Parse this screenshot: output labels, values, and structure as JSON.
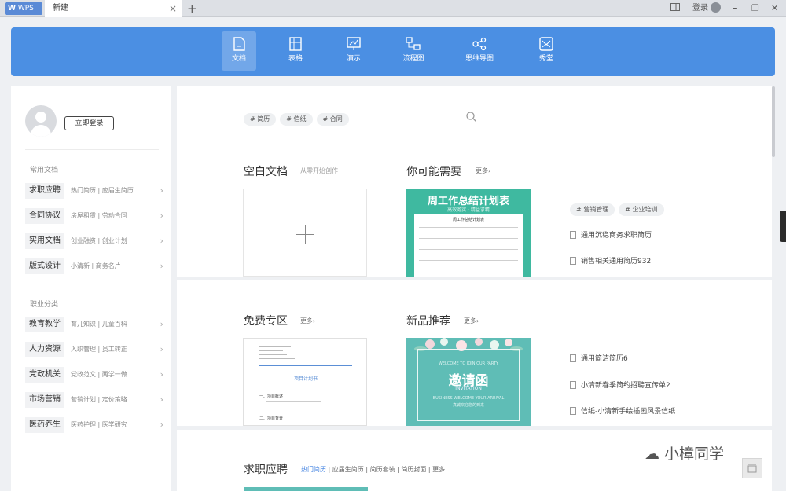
{
  "tabbar": {
    "app_tab": "WPS",
    "doc_tab": "新建",
    "close": "×",
    "new_tab": "+",
    "login": "登录",
    "min": "–",
    "restore": "❐",
    "close_win": "✕"
  },
  "toolbar": {
    "items": [
      {
        "label": "文档",
        "icon": "document-icon"
      },
      {
        "label": "表格",
        "icon": "spreadsheet-icon"
      },
      {
        "label": "演示",
        "icon": "presentation-icon"
      },
      {
        "label": "流程图",
        "icon": "flowchart-icon"
      },
      {
        "label": "思维导图",
        "icon": "mindmap-icon"
      },
      {
        "label": "秀堂",
        "icon": "showcase-icon"
      }
    ],
    "active_index": 0
  },
  "sidebar": {
    "login_button": "立即登录",
    "section1": "常用文档",
    "section2": "职业分类",
    "categories": [
      {
        "name": "求职应聘",
        "sub": "热门简历 | 应届生简历"
      },
      {
        "name": "合同协议",
        "sub": "房屋租赁 | 劳动合同"
      },
      {
        "name": "实用文档",
        "sub": "创业融资 | 创业计划"
      },
      {
        "name": "版式设计",
        "sub": "小清新 | 商务名片"
      },
      {
        "name": "教育教学",
        "sub": "育儿知识 | 儿童百科"
      },
      {
        "name": "人力资源",
        "sub": "入职管理 | 员工转正"
      },
      {
        "name": "党政机关",
        "sub": "党政范文 | 两学一做"
      },
      {
        "name": "市场营销",
        "sub": "营销计划 | 定价策略"
      },
      {
        "name": "医药养生",
        "sub": "医药护理 | 医学研究"
      }
    ],
    "arrow": "›"
  },
  "search": {
    "tags": [
      "# 简历",
      "# 信纸",
      "# 合同"
    ]
  },
  "sections": {
    "blank_title": "空白文档",
    "blank_tagline": "从零开始创作",
    "maybe_title": "你可能需要",
    "more": "更多›",
    "free_title": "免费专区",
    "new_title": "新品推荐",
    "job_title": "求职应聘"
  },
  "thumb_week": {
    "title": "周工作总结计划表",
    "subtitle": "高效务实 · 精益求精",
    "sheet_title": "周工作总结计划表"
  },
  "right_tags": [
    "# 营销管理",
    "# 企业培训"
  ],
  "right_links_1": [
    "通用沉稳商务求职简历",
    "销售相关通用简历932"
  ],
  "right_links_2": [
    "通用简洁简历6",
    "小清新春季简约招聘宣传单2",
    "信纸-小清新手绘插画风景信纸"
  ],
  "doc_thumb": {
    "heading": "项目计划书",
    "item1": "一、项目概述",
    "item2": "二、项目背景"
  },
  "invite": {
    "title": "邀请函",
    "en": "INVITATION",
    "line1": "BUSINESS WELCOME YOUR ARRIVAL",
    "line2": "· 真诚欢迎您的到来 ·",
    "header": "WELCOME TO JOIN OUR PARTY"
  },
  "job_tabs": {
    "active": "热门简历",
    "others": "| 应届生简历 | 简历套装 | 简历封面 | 更多"
  },
  "watermark": "小樟同学"
}
